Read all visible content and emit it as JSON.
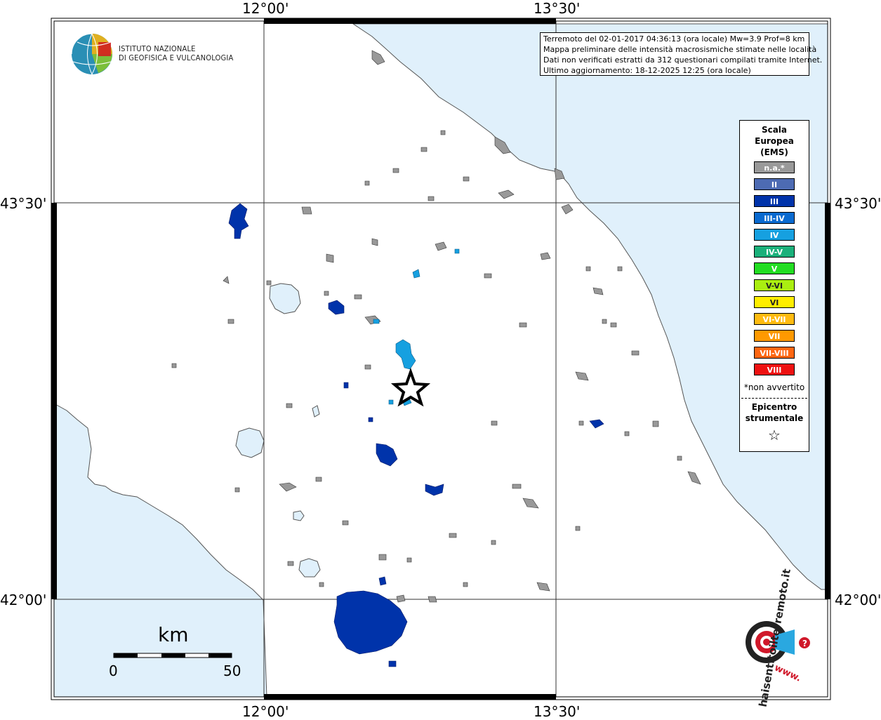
{
  "map": {
    "coords": {
      "lon_left": "12°00'",
      "lon_right": "13°30'",
      "lat_top": "43°30'",
      "lat_bottom": "42°00'"
    },
    "info": {
      "line1": "Terremoto del 02-01-2017 04:36:13 (ora locale) Mw=3.9 Prof=8 km",
      "line2": "Mappa preliminare delle intensità macrosismiche stimate nelle località",
      "line3": "Dati non verificati estratti da 312 questionari compilati tramite Internet.",
      "line4": "Ultimo aggiornamento: 18-12-2025 12:25 (ora locale)"
    },
    "logo": {
      "line1": "ISTITUTO NAZIONALE",
      "line2": "DI GEOFISICA E VULCANOLOGIA"
    },
    "scale_bar": {
      "unit": "km",
      "min": "0",
      "max": "50"
    },
    "legend": {
      "title1": "Scala",
      "title2": "Europea",
      "title3": "(EMS)",
      "items": [
        {
          "label": "n.a.*",
          "color": "#999999"
        },
        {
          "label": "II",
          "color": "#4d6bb3"
        },
        {
          "label": "III",
          "color": "#0033aa"
        },
        {
          "label": "III-IV",
          "color": "#0a6ad0"
        },
        {
          "label": "IV",
          "color": "#16a0e0"
        },
        {
          "label": "IV-V",
          "color": "#1ab07a"
        },
        {
          "label": "V",
          "color": "#22dd22"
        },
        {
          "label": "V-VI",
          "color": "#aaee11"
        },
        {
          "label": "VI",
          "color": "#ffee00"
        },
        {
          "label": "VI-VII",
          "color": "#ffbb11"
        },
        {
          "label": "VII",
          "color": "#ff9900"
        },
        {
          "label": "VII-VIII",
          "color": "#ff6611"
        },
        {
          "label": "VIII",
          "color": "#ee1111"
        }
      ],
      "not_felt": "*non avvertito",
      "epicenter1": "Epicentro",
      "epicenter2": "strumentale",
      "epicenter_symbol": "☆"
    },
    "colors": {
      "sea": "#e0f0fb",
      "land": "#ffffff",
      "lake": "#e0f0fb",
      "na_gray": "#999999",
      "ems_III": "#0033aa",
      "ems_IV": "#16a0e0"
    },
    "hsit_logo": {
      "text": "haisentitoilterremoto.it",
      "url": "www."
    }
  }
}
